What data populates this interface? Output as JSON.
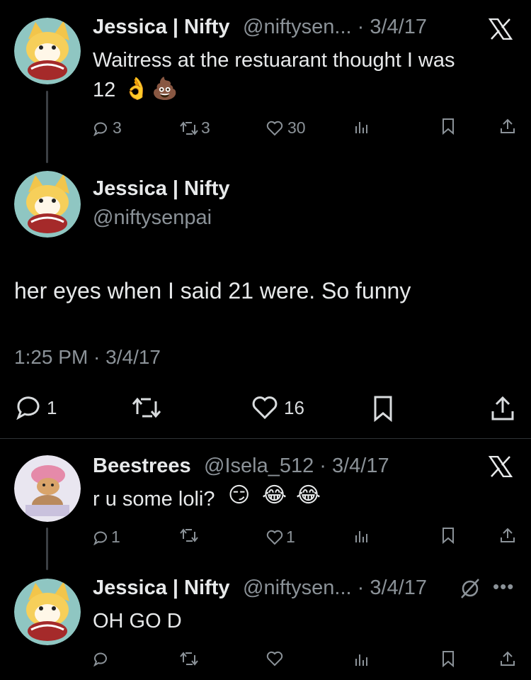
{
  "tweets": [
    {
      "name": "Jessica | Nifty",
      "handle_date": "@niftysen... · 3/4/17",
      "text_line1": "Waitress at the restuarant thought I was",
      "text_line2": "12",
      "emoji": [
        "ok-hand",
        "pile-of-poo"
      ],
      "replies": "3",
      "reposts": "3",
      "likes": "30"
    },
    {
      "name": "Jessica | Nifty",
      "handle": "@niftysenpai",
      "text": "her eyes when I said 21 were. So funny",
      "timestamp": "1:25 PM · 3/4/17",
      "replies": "1",
      "likes": "16"
    },
    {
      "name": "Beestrees",
      "handle_date": "@Isela_512 · 3/4/17",
      "text": "r u some loli?",
      "emoji": [
        "smirking-face",
        "face-with-tears-of-joy",
        "face-with-tears-of-joy"
      ],
      "replies": "1",
      "likes": "1"
    },
    {
      "name": "Jessica | Nifty",
      "handle_date": "@niftysen... · 3/4/17",
      "text": "OH GO D"
    }
  ],
  "colors": {
    "background": "#000000",
    "text": "#e7e9ea",
    "secondary": "#8b9298",
    "divider": "#2f3336"
  }
}
